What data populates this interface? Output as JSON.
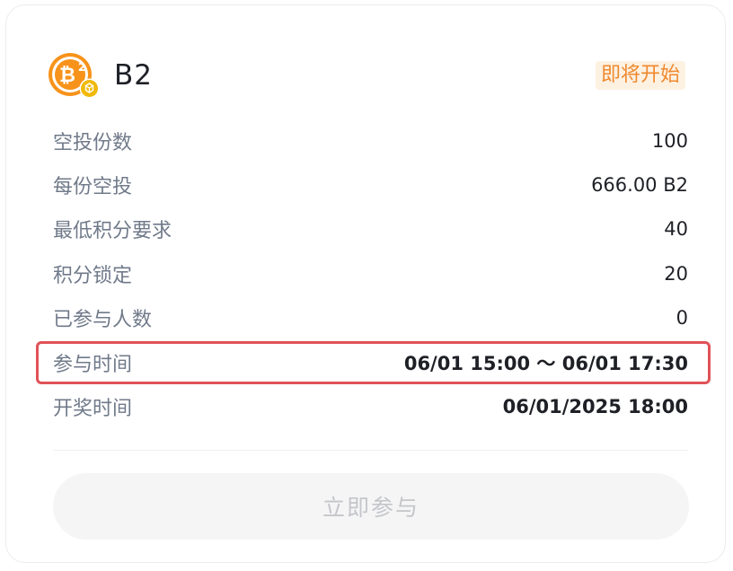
{
  "token": {
    "name": "B2",
    "logo_icon": "bitcoin-b2-coin-icon",
    "badge_icon": "bnb-chain-badge-icon"
  },
  "status": {
    "label": "即将开始",
    "color": "#f0892e",
    "background": "#fdf1e2"
  },
  "details": [
    {
      "label": "空投份数",
      "value": "100"
    },
    {
      "label": "每份空投",
      "value": "666.00 B2"
    },
    {
      "label": "最低积分要求",
      "value": "40"
    },
    {
      "label": "积分锁定",
      "value": "20"
    },
    {
      "label": "已参与人数",
      "value": "0"
    },
    {
      "label": "参与时间",
      "value": "06/01 15:00 ～ 06/01 17:30"
    },
    {
      "label": "开奖时间",
      "value": "06/01/2025 18:00"
    }
  ],
  "action": {
    "join_label": "立即参与"
  },
  "colors": {
    "highlight_border": "#e05257",
    "label_text": "#707a8a",
    "value_text": "#1e2026"
  }
}
